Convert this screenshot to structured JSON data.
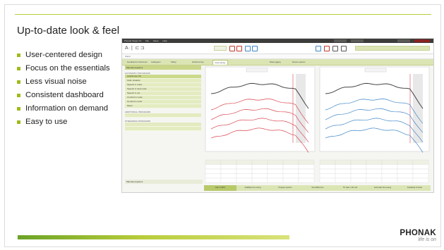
{
  "slide": {
    "title": "Up-to-date look & feel",
    "bullets": [
      "User-centered design",
      "Focus on the essentials",
      "Less visual noise",
      "Consistent dashboard",
      "Information on demand",
      "Easy to use"
    ],
    "brand": {
      "name": "PHONAK",
      "tagline": "life is on"
    },
    "colors": {
      "accent": "#a2b91c",
      "bar_start": "#6aa326",
      "bar_end": "#d9e37a"
    }
  },
  "app": {
    "menu": [
      "Phonak Target 4.0",
      "File",
      "Setup",
      "Help"
    ],
    "logo": "A·| ⊏⊐",
    "client_label": "Client",
    "tabs": [
      "Feedback & instrument",
      "Audiogram",
      "Fitting",
      "Global tuning",
      "Fine tuning",
      "Data logging",
      "Device options"
    ],
    "sidebar": {
      "header": "Manual programs",
      "section1": "AUTOMATIC PROGRAMS",
      "items": [
        "AutoSense OS",
        "Calm situation",
        "Speech in noise",
        "Speech in loud noise",
        "Speech in car",
        "Comfort in noise",
        "Comfort in echo",
        "Music"
      ],
      "section2": "ADDITIONAL PROGRAMS",
      "section3": "STREAMING PROGRAMS",
      "footer": "Manual programs"
    },
    "charts": {
      "left_label": "Curves: 65 dB input",
      "right_label": "Curves: 65 dB input",
      "left_colors": [
        "#444444",
        "#d9444f",
        "#d9444f",
        "#d9444f",
        "#d9444f"
      ],
      "right_colors": [
        "#444444",
        "#3f86c9",
        "#3f86c9",
        "#3f86c9",
        "#3f86c9"
      ],
      "x_label": "kHz"
    },
    "bottom_tabs": [
      "Gain & MPO",
      "Audibility fine tuning",
      "Program options",
      "SoundRecover",
      "TK Gain / CR soft",
      "Automatic fine tuning",
      "Feedback & Noise"
    ]
  }
}
